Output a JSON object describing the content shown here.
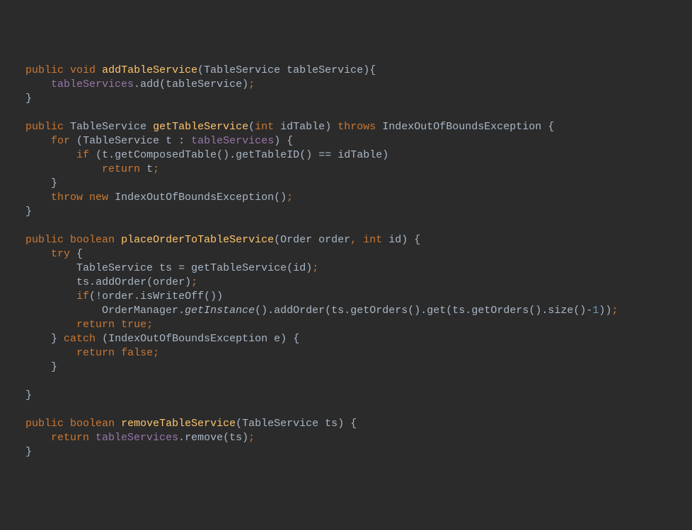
{
  "code": {
    "line1": {
      "indent": "    ",
      "kw1": "public",
      "sp1": " ",
      "kw2": "void",
      "sp2": " ",
      "method": "addTableService",
      "p1": "(",
      "type": "TableService",
      "sp3": " ",
      "param": "tableService",
      "p2": ")",
      "brace": "{"
    },
    "line2": {
      "indent": "        ",
      "field": "tableServices",
      "dot": ".",
      "call": "add",
      "p1": "(",
      "arg": "tableService",
      "p2": ")",
      "semi": ";"
    },
    "line3": {
      "indent": "    ",
      "brace": "}"
    },
    "line5": {
      "indent": "    ",
      "kw1": "public",
      "sp1": " ",
      "type1": "TableService",
      "sp2": " ",
      "method": "getTableService",
      "p1": "(",
      "kw2": "int",
      "sp3": " ",
      "param": "idTable",
      "p2": ")",
      "sp4": " ",
      "kw3": "throws",
      "sp5": " ",
      "type2": "IndexOutOfBoundsException",
      "sp6": " ",
      "brace": "{"
    },
    "line6": {
      "indent": "        ",
      "kw1": "for",
      "sp1": " ",
      "p1": "(",
      "type": "TableService",
      "sp2": " ",
      "var": "t",
      "sp3": " ",
      "colon": ":",
      "sp4": " ",
      "field": "tableServices",
      "p2": ")",
      "sp5": " ",
      "brace": "{"
    },
    "line7": {
      "indent": "            ",
      "kw1": "if",
      "sp1": " ",
      "p1": "(",
      "var": "t",
      "dot1": ".",
      "call1": "getComposedTable",
      "p2": "()",
      "dot2": ".",
      "call2": "getTableID",
      "p3": "()",
      "sp2": " ",
      "op": "==",
      "sp3": " ",
      "param": "idTable",
      "p4": ")"
    },
    "line8": {
      "indent": "                ",
      "kw": "return",
      "sp": " ",
      "var": "t",
      "semi": ";"
    },
    "line9": {
      "indent": "        ",
      "brace": "}"
    },
    "line10": {
      "indent": "        ",
      "kw1": "throw",
      "sp1": " ",
      "kw2": "new",
      "sp2": " ",
      "type": "IndexOutOfBoundsException",
      "p": "()",
      "semi": ";"
    },
    "line11": {
      "indent": "    ",
      "brace": "}"
    },
    "line13": {
      "indent": "    ",
      "kw1": "public",
      "sp1": " ",
      "kw2": "boolean",
      "sp2": " ",
      "method": "placeOrderToTableService",
      "p1": "(",
      "type": "Order",
      "sp3": " ",
      "param1": "order",
      "comma": ",",
      "sp4": " ",
      "kw3": "int",
      "sp5": " ",
      "param2": "id",
      "p2": ")",
      "sp6": " ",
      "brace": "{"
    },
    "line14": {
      "indent": "        ",
      "kw": "try",
      "sp": " ",
      "brace": "{"
    },
    "line15": {
      "indent": "            ",
      "type": "TableService",
      "sp1": " ",
      "var": "ts",
      "sp2": " ",
      "eq": "=",
      "sp3": " ",
      "call": "getTableService",
      "p1": "(",
      "param": "id",
      "p2": ")",
      "semi": ";"
    },
    "line16": {
      "indent": "            ",
      "var": "ts",
      "dot": ".",
      "call": "addOrder",
      "p1": "(",
      "param": "order",
      "p2": ")",
      "semi": ";"
    },
    "line17": {
      "indent": "            ",
      "kw": "if",
      "p1": "(",
      "neg": "!",
      "param": "order",
      "dot": ".",
      "call": "isWriteOff",
      "p2": "()",
      "p3": ")"
    },
    "line18": {
      "indent": "                ",
      "type": "OrderManager",
      "dot1": ".",
      "scall": "getInstance",
      "p1": "()",
      "dot2": ".",
      "call1": "addOrder",
      "p2": "(",
      "var1": "ts",
      "dot3": ".",
      "call2": "getOrders",
      "p3": "()",
      "dot4": ".",
      "call3": "get",
      "p4": "(",
      "var2": "ts",
      "dot5": ".",
      "call4": "getOrders",
      "p5": "()",
      "dot6": ".",
      "call5": "size",
      "p6": "()",
      "minus": "-",
      "num": "1",
      "p7": ")",
      "p8": ")",
      "semi": ";"
    },
    "line19": {
      "indent": "            ",
      "kw1": "return",
      "sp": " ",
      "kw2": "true",
      "semi": ";"
    },
    "line20": {
      "indent": "        ",
      "brace1": "}",
      "sp1": " ",
      "kw": "catch",
      "sp2": " ",
      "p1": "(",
      "type": "IndexOutOfBoundsException",
      "sp3": " ",
      "param": "e",
      "p2": ")",
      "sp4": " ",
      "brace2": "{"
    },
    "line21": {
      "indent": "            ",
      "kw1": "return",
      "sp": " ",
      "kw2": "false",
      "semi": ";"
    },
    "line22": {
      "indent": "        ",
      "brace": "}"
    },
    "line24": {
      "indent": "    ",
      "brace": "}"
    },
    "line26": {
      "indent": "    ",
      "kw1": "public",
      "sp1": " ",
      "kw2": "boolean",
      "sp2": " ",
      "method": "removeTableService",
      "p1": "(",
      "type": "TableService",
      "sp3": " ",
      "param": "ts",
      "p2": ")",
      "sp4": " ",
      "brace": "{"
    },
    "line27": {
      "indent": "        ",
      "kw": "return",
      "sp": " ",
      "field": "tableServices",
      "dot": ".",
      "call": "remove",
      "p1": "(",
      "param": "ts",
      "p2": ")",
      "semi": ";"
    },
    "line28": {
      "indent": "    ",
      "brace": "}"
    }
  }
}
